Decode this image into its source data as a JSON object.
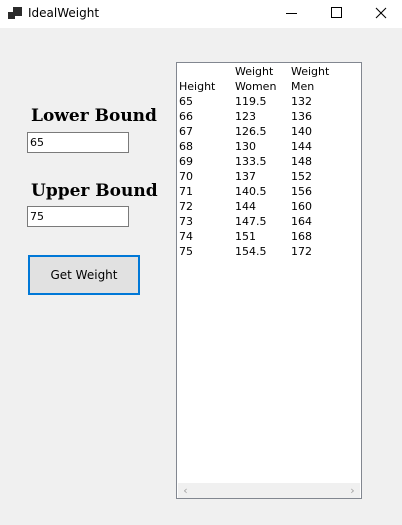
{
  "window": {
    "title": "IdealWeight"
  },
  "form": {
    "lower_label": "Lower Bound",
    "lower_value": "65",
    "upper_label": "Upper Bound",
    "upper_value": "75",
    "button_label": "Get Weight"
  },
  "listbox": {
    "header1": [
      "",
      "Weight",
      "Weight"
    ],
    "header2": [
      "Height",
      "Women",
      "Men"
    ],
    "rows": [
      [
        "65",
        "119.5",
        "132"
      ],
      [
        "66",
        "123",
        "136"
      ],
      [
        "67",
        "126.5",
        "140"
      ],
      [
        "68",
        "130",
        "144"
      ],
      [
        "69",
        "133.5",
        "148"
      ],
      [
        "70",
        "137",
        "152"
      ],
      [
        "71",
        "140.5",
        "156"
      ],
      [
        "72",
        "144",
        "160"
      ],
      [
        "73",
        "147.5",
        "164"
      ],
      [
        "74",
        "151",
        "168"
      ],
      [
        "75",
        "154.5",
        "172"
      ]
    ]
  },
  "icons": {
    "app": "app-icon",
    "minimize": "minimize-icon",
    "maximize": "maximize-icon",
    "close": "close-icon",
    "scroll_left": "chevron-left-icon",
    "scroll_right": "chevron-right-icon"
  }
}
